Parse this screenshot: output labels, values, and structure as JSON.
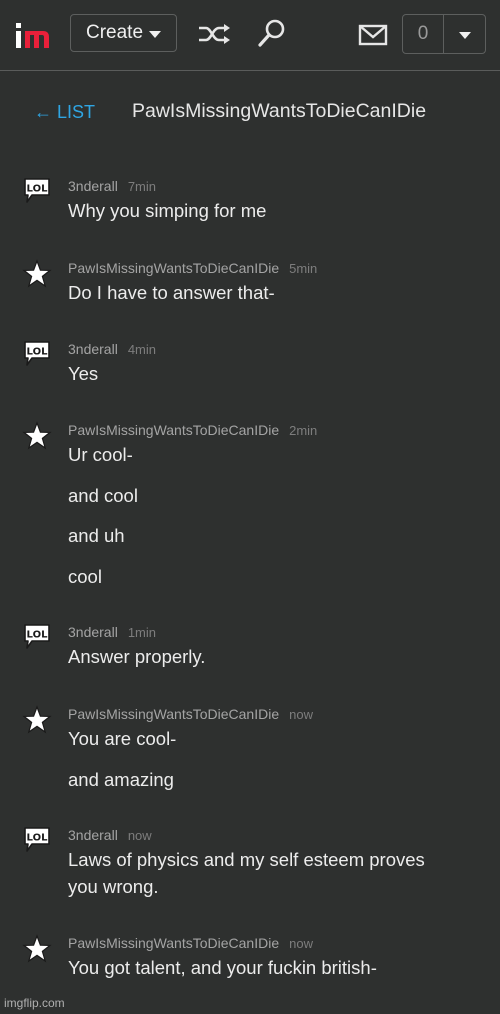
{
  "nav": {
    "logo_text": "im",
    "create_label": "Create",
    "notification_count": "0"
  },
  "header": {
    "back_label": "← LIST",
    "title": "PawIsMissingWantsToDieCanIDie"
  },
  "messages": [
    {
      "user": "3nderall",
      "time": "7min",
      "avatar": "lol-icon",
      "lines": [
        "Why you simping for me"
      ]
    },
    {
      "user": "PawIsMissingWantsToDieCanIDie",
      "time": "5min",
      "avatar": "star-icon",
      "lines": [
        "Do I have to answer that-"
      ]
    },
    {
      "user": "3nderall",
      "time": "4min",
      "avatar": "lol-icon",
      "lines": [
        "Yes"
      ]
    },
    {
      "user": "PawIsMissingWantsToDieCanIDie",
      "time": "2min",
      "avatar": "star-icon",
      "lines": [
        "Ur cool-",
        "and cool",
        "and uh",
        "cool"
      ]
    },
    {
      "user": "3nderall",
      "time": "1min",
      "avatar": "lol-icon",
      "lines": [
        "Answer properly."
      ]
    },
    {
      "user": "PawIsMissingWantsToDieCanIDie",
      "time": "now",
      "avatar": "star-icon",
      "lines": [
        "You are cool-",
        "and amazing"
      ]
    },
    {
      "user": "3nderall",
      "time": "now",
      "avatar": "lol-icon",
      "lines": [
        "Laws of physics and my self esteem proves",
        "you wrong."
      ]
    },
    {
      "user": "PawIsMissingWantsToDieCanIDie",
      "time": "now",
      "avatar": "star-icon",
      "lines": [
        "You got talent, and your fuckin british-"
      ]
    }
  ],
  "avatar_label": "LOL",
  "watermark": "imgflip.com",
  "colors": {
    "background": "#2e302f",
    "accent_link": "#2fa5e3",
    "logo_red": "#e8203a"
  }
}
